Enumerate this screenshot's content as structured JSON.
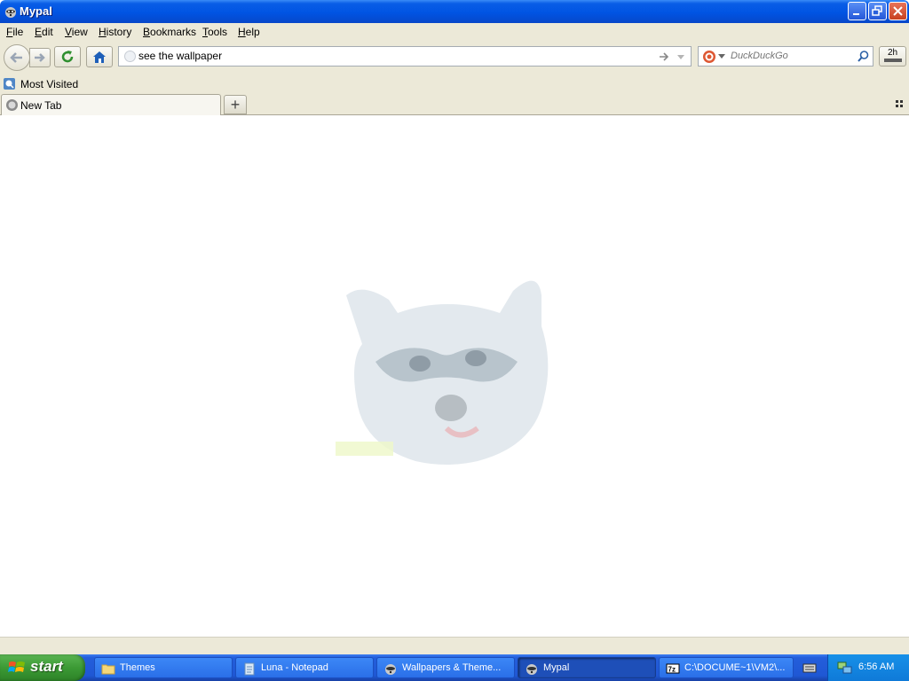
{
  "window": {
    "title": "Mypal"
  },
  "menubar": {
    "items": [
      {
        "label": "File",
        "key": "F",
        "rest": "ile"
      },
      {
        "label": "Edit",
        "key": "E",
        "rest": "dit"
      },
      {
        "label": "View",
        "key": "V",
        "rest": "iew"
      },
      {
        "label": "History",
        "key": "H",
        "rest": "istory"
      },
      {
        "label": "Bookmarks",
        "key": "B",
        "rest": "ookmarks"
      },
      {
        "label": "Tools",
        "key": "T",
        "rest": "ools"
      },
      {
        "label": "Help",
        "key": "H",
        "rest": "elp"
      }
    ]
  },
  "navbar": {
    "url_value": "see the wallpaper ",
    "search_placeholder": "DuckDuckGo",
    "extra_button_label": "2h"
  },
  "bookmarks": {
    "most_visited": "Most Visited"
  },
  "tabs": {
    "active_label": "New Tab"
  },
  "taskbar": {
    "start_label": "start",
    "tasks": [
      {
        "label": "Themes",
        "icon": "folder-icon"
      },
      {
        "label": "Luna - Notepad",
        "icon": "notepad-icon"
      },
      {
        "label": "Wallpapers & Theme...",
        "icon": "raccoon-icon"
      },
      {
        "label": "Mypal",
        "icon": "raccoon-icon"
      },
      {
        "label": "C:\\DOCUME~1\\VM2\\...",
        "icon": "7zip-icon"
      }
    ],
    "clock": "6:56 AM"
  },
  "colors": {
    "titlebar": "#0054e3",
    "chrome": "#ece9d8",
    "taskbar": "#245edb",
    "start": "#3c9a35"
  }
}
